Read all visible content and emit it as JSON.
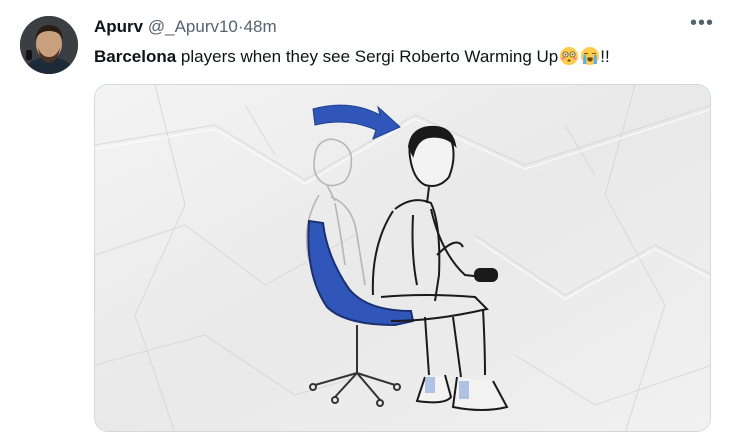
{
  "tweet": {
    "author_name": "Apurv",
    "handle": "@_Apurv10",
    "separator": "·",
    "time": "48m",
    "text_bold": "Barcelona",
    "text_rest": " players when they see Sergi Roberto Warming Up",
    "text_end": "!!",
    "emojis": [
      "flushed-face-emoji",
      "loudly-crying-face-emoji"
    ]
  },
  "media": {
    "description_icon": "sketch-illustration",
    "chair_color": "#2f56b8",
    "arrow_color": "#2f56b8"
  },
  "colors": {
    "text_primary": "#0f1419",
    "text_secondary": "#536471",
    "border": "#cfd9de"
  }
}
